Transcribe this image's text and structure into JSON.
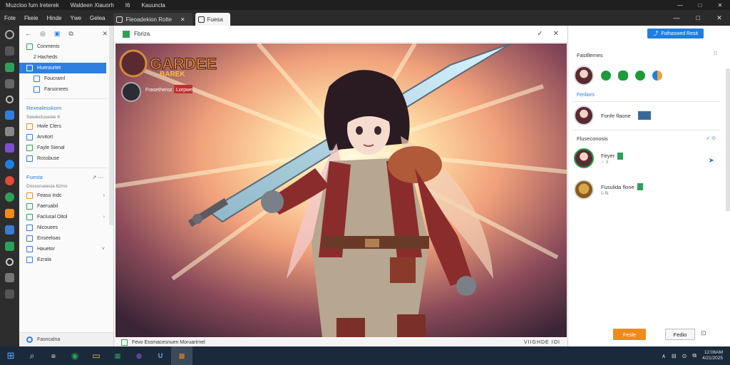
{
  "titlebar": {
    "items": [
      "Muzcloo fum Ireterek",
      "Waldeen Xiauorh",
      "I6",
      "Kauuncla"
    ],
    "controls": [
      "—",
      "□",
      "✕"
    ]
  },
  "menubar": {
    "menus": [
      "Fote",
      "Fkeie",
      "Hinde",
      "Ywe",
      "Gelea"
    ],
    "tab_active": "Fleoadekion Rolte",
    "tab_active_close": "✕",
    "tab_light": "Fuesa",
    "controls": [
      "—",
      "□",
      "✕"
    ]
  },
  "sidebar": {
    "toolbar": [
      "←",
      "◎",
      "▣",
      "⧉",
      "✕"
    ],
    "group1": [
      "Conmenis",
      "2 Hacheds",
      "Hueraurtet",
      "Foucraml",
      "Faruonees"
    ],
    "section2_title": "Rexealesskom",
    "section2_sub": "Sewiecluseste 6",
    "group2": [
      "Hwle Clers",
      "Arvitort",
      "Fayle Sienal",
      "Rossbuse"
    ],
    "section3_title": "Fuesta",
    "section3_sub": "Dossorueesia 62ms",
    "section3_icons": "↗ ⋯",
    "group3": [
      "Feaso Indc",
      "Faeruabil",
      "Faclusal Oitol",
      "Nicouees",
      "Enseeloas",
      "Hauetor",
      "Ezrala"
    ],
    "bottom_label": "Fasncalna"
  },
  "viewer": {
    "title": "Fbriza",
    "actions": [
      "✓",
      "✕"
    ],
    "logo_text": "GARDEE",
    "logo_sub": "BAREK",
    "badge_text": "Frasetheroz",
    "badge_tag": "Lorpwe",
    "footer_left": "Fevo Essmacesnuen Moruarirnel",
    "footer_right": "VIIGHDE IOI"
  },
  "right_panel": {
    "share_label": "Foihaswed Resit",
    "title": "Fastllernes",
    "close": "⁝⁝",
    "reaction_colors": [
      "#1f9a3a",
      "#1f9a3a",
      "#1f9a3a",
      "#f2a33a"
    ],
    "link1": "Fenliors",
    "user1_name": "Fonfe flaone",
    "section2": "Fluseconosis",
    "section2_right": "✓ ⊙",
    "user2_name": "Feyer",
    "user2_sub": "♀ 3",
    "user3_name": "Fusulida flone",
    "user3_sub": "0 ℞",
    "btn_primary": "Fesle",
    "btn_secondary": "Fedio",
    "btn_icon": "⊡"
  },
  "taskbar": {
    "apps": [
      "⊞",
      "⌕",
      "⧈",
      "◉",
      "▭",
      "▦",
      "◍",
      "U",
      "▩"
    ],
    "tray": [
      "∧",
      "⊟",
      "⊙",
      "⧉"
    ],
    "clock_time": "12:06AM",
    "clock_date": "4/21/2025"
  },
  "colors": {
    "accent": "#2f7fe0",
    "orange": "#f08a1c",
    "taskbar": "#1b2a3a"
  }
}
